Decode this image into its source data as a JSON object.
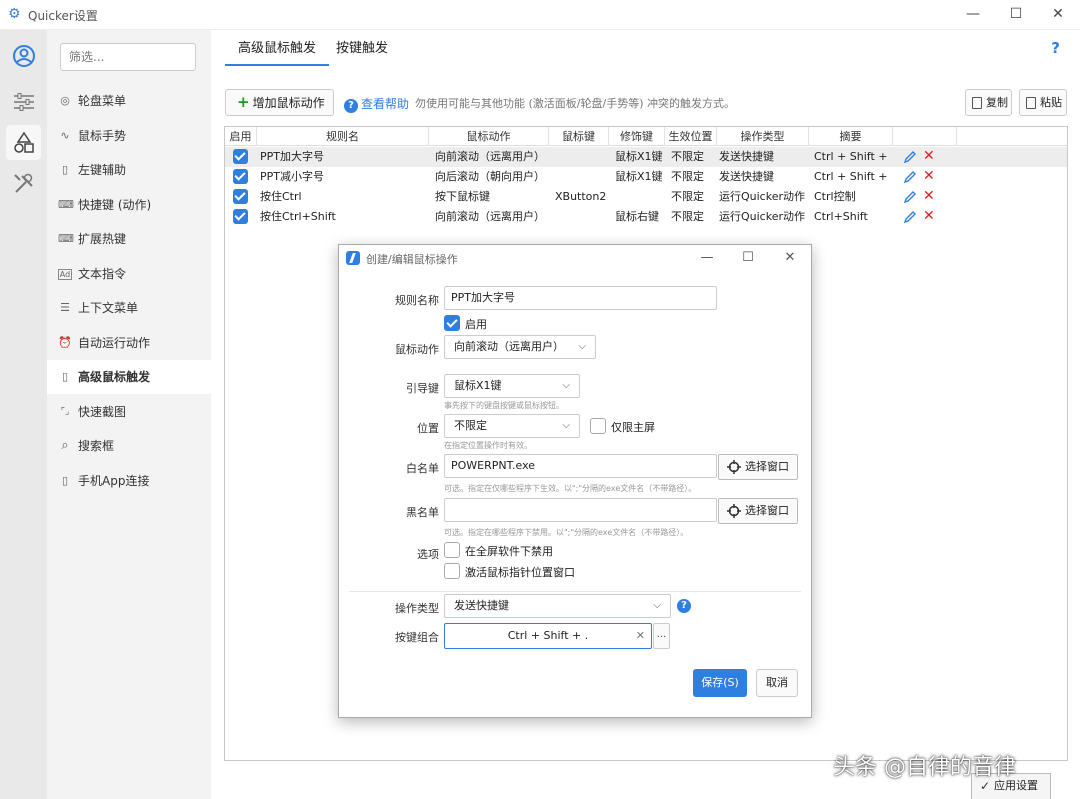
{
  "window": {
    "title": "Quicker设置",
    "min": "—",
    "max": "☐",
    "close": "✕"
  },
  "filter": {
    "placeholder": "筛选..."
  },
  "nav": {
    "items": [
      {
        "label": "轮盘菜单",
        "icon": "◎"
      },
      {
        "label": "鼠标手势",
        "icon": "∿"
      },
      {
        "label": "左键辅助",
        "icon": "▯"
      },
      {
        "label": "快捷键 (动作)",
        "icon": "⌨"
      },
      {
        "label": "扩展热键",
        "icon": "⌨"
      },
      {
        "label": "文本指令",
        "icon": "Ad"
      },
      {
        "label": "上下文菜单",
        "icon": "☰"
      },
      {
        "label": "自动运行动作",
        "icon": "⏰"
      },
      {
        "label": "高级鼠标触发",
        "icon": "▯"
      },
      {
        "label": "快速截图",
        "icon": "⌜⌟"
      },
      {
        "label": "搜索框",
        "icon": "⌕"
      },
      {
        "label": "手机App连接",
        "icon": "▯"
      }
    ]
  },
  "tabs": [
    {
      "label": "高级鼠标触发"
    },
    {
      "label": "按键触发"
    }
  ],
  "help_q": "?",
  "toolbar": {
    "add": "增加鼠标动作",
    "help": "查看帮助",
    "hint": "勿使用可能与其他功能 (激活面板/轮盘/手势等) 冲突的触发方式。",
    "copy": "复制",
    "paste": "粘贴"
  },
  "grid": {
    "headers": [
      "启用",
      "规则名",
      "鼠标动作",
      "鼠标键",
      "修饰键",
      "生效位置",
      "操作类型",
      "摘要"
    ],
    "rows": [
      {
        "name": "PPT加大字号",
        "action": "向前滚动（远离用户）",
        "button": "",
        "modifier": "鼠标X1键",
        "position": "不限定",
        "type": "发送快捷键",
        "summary": "Ctrl + Shift + ."
      },
      {
        "name": "PPT减小字号",
        "action": "向后滚动（朝向用户）",
        "button": "",
        "modifier": "鼠标X1键",
        "position": "不限定",
        "type": "发送快捷键",
        "summary": "Ctrl + Shift + ,"
      },
      {
        "name": "按住Ctrl",
        "action": "按下鼠标键",
        "button": "XButton2",
        "modifier": "",
        "position": "不限定",
        "type": "运行Quicker动作",
        "summary": "Ctrl控制"
      },
      {
        "name": "按住Ctrl+Shift",
        "action": "向前滚动（远离用户）",
        "button": "",
        "modifier": "鼠标右键",
        "position": "不限定",
        "type": "运行Quicker动作",
        "summary": "Ctrl+Shift"
      }
    ]
  },
  "dialog": {
    "title": "创建/编辑鼠标操作",
    "rule_name_label": "规则名称",
    "rule_name_value": "PPT加大字号",
    "enable_label": "启用",
    "mouse_action_label": "鼠标动作",
    "mouse_action_value": "向前滚动（远离用户）",
    "lead_key_label": "引导键",
    "lead_key_value": "鼠标X1键",
    "lead_key_hint": "事先按下的键盘按键或鼠标按钮。",
    "position_label": "位置",
    "position_value": "不限定",
    "main_screen_label": "仅限主屏",
    "position_hint": "在指定位置操作时有效。",
    "whitelist_label": "白名单",
    "whitelist_value": "POWERPNT.exe",
    "whitelist_hint": "可选。指定在仅哪些程序下生效。以\";\"分隔的exe文件名（不带路径）。",
    "blacklist_label": "黑名单",
    "blacklist_value": "",
    "blacklist_hint": "可选。指定在哪些程序下禁用。以\";\"分隔的exe文件名（不带路径）。",
    "pick_window": "选择窗口",
    "options_label": "选项",
    "option1": "在全屏软件下禁用",
    "option2": "激活鼠标指针位置窗口",
    "op_type_label": "操作类型",
    "op_type_value": "发送快捷键",
    "key_combo_label": "按键组合",
    "key_combo_value": "Ctrl + Shift + .",
    "save": "保存(S)",
    "cancel": "取消"
  },
  "apply": "应用设置",
  "watermark": "头条 @自律的音律",
  "colors": {
    "accent": "#2f7fe0",
    "delete": "#e02020",
    "add": "#1a9a1a"
  }
}
